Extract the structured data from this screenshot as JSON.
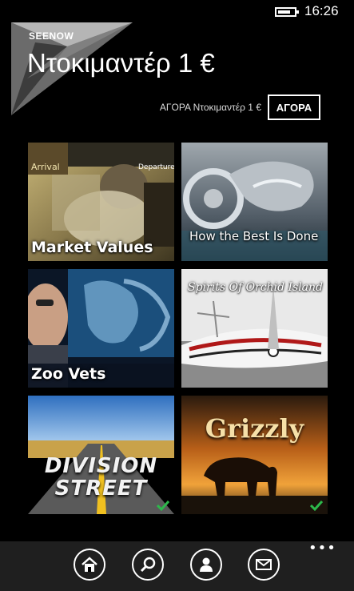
{
  "status_bar": {
    "time": "16:26",
    "battery_icon": "battery-icon"
  },
  "header": {
    "brand": "SEENOW",
    "title": "Ντοκιμαντέρ  1 €",
    "logo_colors": [
      "#5a5a5a",
      "#9a9a9a",
      "#d0d0d0"
    ]
  },
  "purchase": {
    "description": "ΑΓΟΡΑ Ντοκιμαντέρ  1 €",
    "button_label": "ΑΓΟΡΑ"
  },
  "tiles": [
    {
      "label": "Market Values",
      "sub_left": "Arrival",
      "sub_right": "Departure",
      "watched": false
    },
    {
      "label": "How the Best Is Done",
      "watched": false
    },
    {
      "label": "Zoo Vets",
      "watched": false
    },
    {
      "label": "Spirits Of Orchid Island",
      "watched": false
    },
    {
      "label": "DIVISION STREET",
      "watched": true
    },
    {
      "label": "Grizzly",
      "watched": true
    }
  ],
  "app_bar": {
    "more_label": "•••",
    "buttons": [
      {
        "icon": "home-icon"
      },
      {
        "icon": "search-icon"
      },
      {
        "icon": "profile-icon"
      },
      {
        "icon": "mail-icon"
      }
    ]
  },
  "colors": {
    "accent": "#ffffff",
    "check": "#2db84b",
    "app_bar": "#1f1f1f"
  }
}
